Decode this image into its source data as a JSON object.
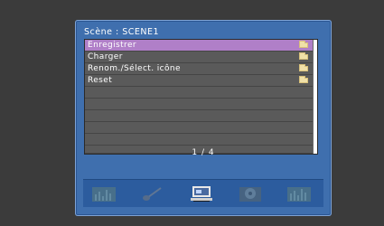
{
  "header": {
    "title": "Scène : SCENE1"
  },
  "menu": {
    "items": [
      {
        "label": "Enregistrer",
        "icon": "folder-icon",
        "selected": true
      },
      {
        "label": "Charger",
        "icon": "folder-icon",
        "selected": false
      },
      {
        "label": "Renom./Sélect. icône",
        "icon": "folder-icon",
        "selected": false
      },
      {
        "label": "Reset",
        "icon": "folder-icon",
        "selected": false
      }
    ],
    "empty_rows": 4
  },
  "pagination": {
    "text": "1 / 4"
  },
  "scene_icons": [
    {
      "icon": "speaker-icon",
      "active": false
    },
    {
      "icon": "guitar-icon",
      "active": false
    },
    {
      "icon": "tv-icon",
      "active": true
    },
    {
      "icon": "disc-icon",
      "active": false
    },
    {
      "icon": "speaker-icon",
      "active": false
    }
  ],
  "colors": {
    "panel": "#3f6fae",
    "selection": "#b07fc8",
    "row": "#5a5a5a",
    "bottom_bar": "#2c5c9e"
  }
}
